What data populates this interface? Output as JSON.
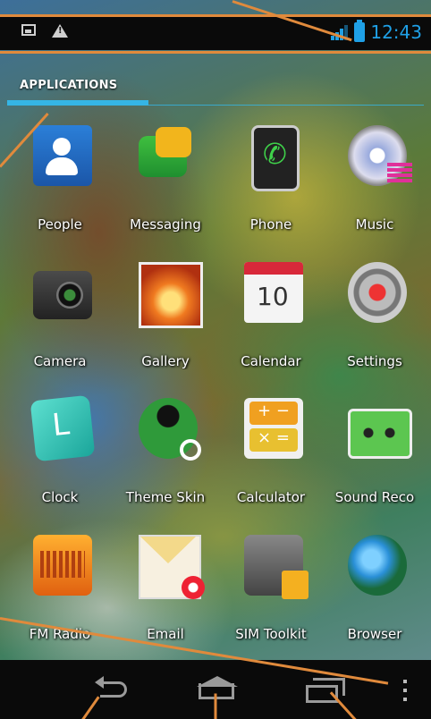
{
  "status_bar": {
    "time": "12:43",
    "left_icons": [
      "picture-icon",
      "warning-icon"
    ],
    "right_icons": [
      "signal-icon",
      "battery-icon"
    ]
  },
  "tabs": {
    "active": "APPLICATIONS"
  },
  "apps": [
    {
      "label": "People",
      "icon": "people-icon"
    },
    {
      "label": "Messaging",
      "icon": "messaging-icon"
    },
    {
      "label": "Phone",
      "icon": "phone-icon"
    },
    {
      "label": "Music",
      "icon": "music-icon"
    },
    {
      "label": "Camera",
      "icon": "camera-icon"
    },
    {
      "label": "Gallery",
      "icon": "gallery-icon"
    },
    {
      "label": "Calendar",
      "icon": "calendar-icon",
      "icon_text": "10"
    },
    {
      "label": "Settings",
      "icon": "settings-icon"
    },
    {
      "label": "Clock",
      "icon": "clock-icon"
    },
    {
      "label": "Theme Skin",
      "icon": "theme-skin-icon"
    },
    {
      "label": "Calculator",
      "icon": "calculator-icon"
    },
    {
      "label": "Sound Reco",
      "icon": "sound-recorder-icon"
    },
    {
      "label": "FM Radio",
      "icon": "fm-radio-icon"
    },
    {
      "label": "Email",
      "icon": "email-icon"
    },
    {
      "label": "SIM Toolkit",
      "icon": "sim-toolkit-icon"
    },
    {
      "label": "Browser",
      "icon": "browser-icon"
    }
  ],
  "nav_bar": {
    "buttons": [
      "back-icon",
      "home-icon",
      "recent-apps-icon",
      "menu-icon"
    ]
  },
  "colors": {
    "accent": "#35b5e5",
    "annotation": "#e08a3c",
    "bars": "#0a0a0a"
  }
}
